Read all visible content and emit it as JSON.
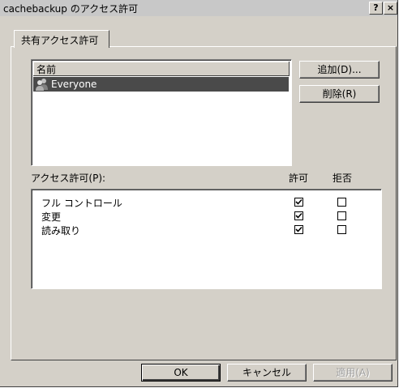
{
  "window": {
    "title": "cachebackup のアクセス許可",
    "help_button": "?",
    "close_button": "×"
  },
  "tab": {
    "label": "共有アクセス許可"
  },
  "names_list": {
    "header": "名前",
    "items": [
      {
        "label": "Everyone",
        "icon": "users-group-icon",
        "selected": true
      }
    ]
  },
  "buttons": {
    "add": "追加(D)...",
    "remove": "削除(R)",
    "ok": "OK",
    "cancel": "キャンセル",
    "apply": "適用(A)"
  },
  "permissions": {
    "label": "アクセス許可(P):",
    "allow_header": "許可",
    "deny_header": "拒否",
    "rows": [
      {
        "name": "フル コントロール",
        "allow": true,
        "deny": false
      },
      {
        "name": "変更",
        "allow": true,
        "deny": false
      },
      {
        "name": "読み取り",
        "allow": true,
        "deny": false
      }
    ]
  }
}
